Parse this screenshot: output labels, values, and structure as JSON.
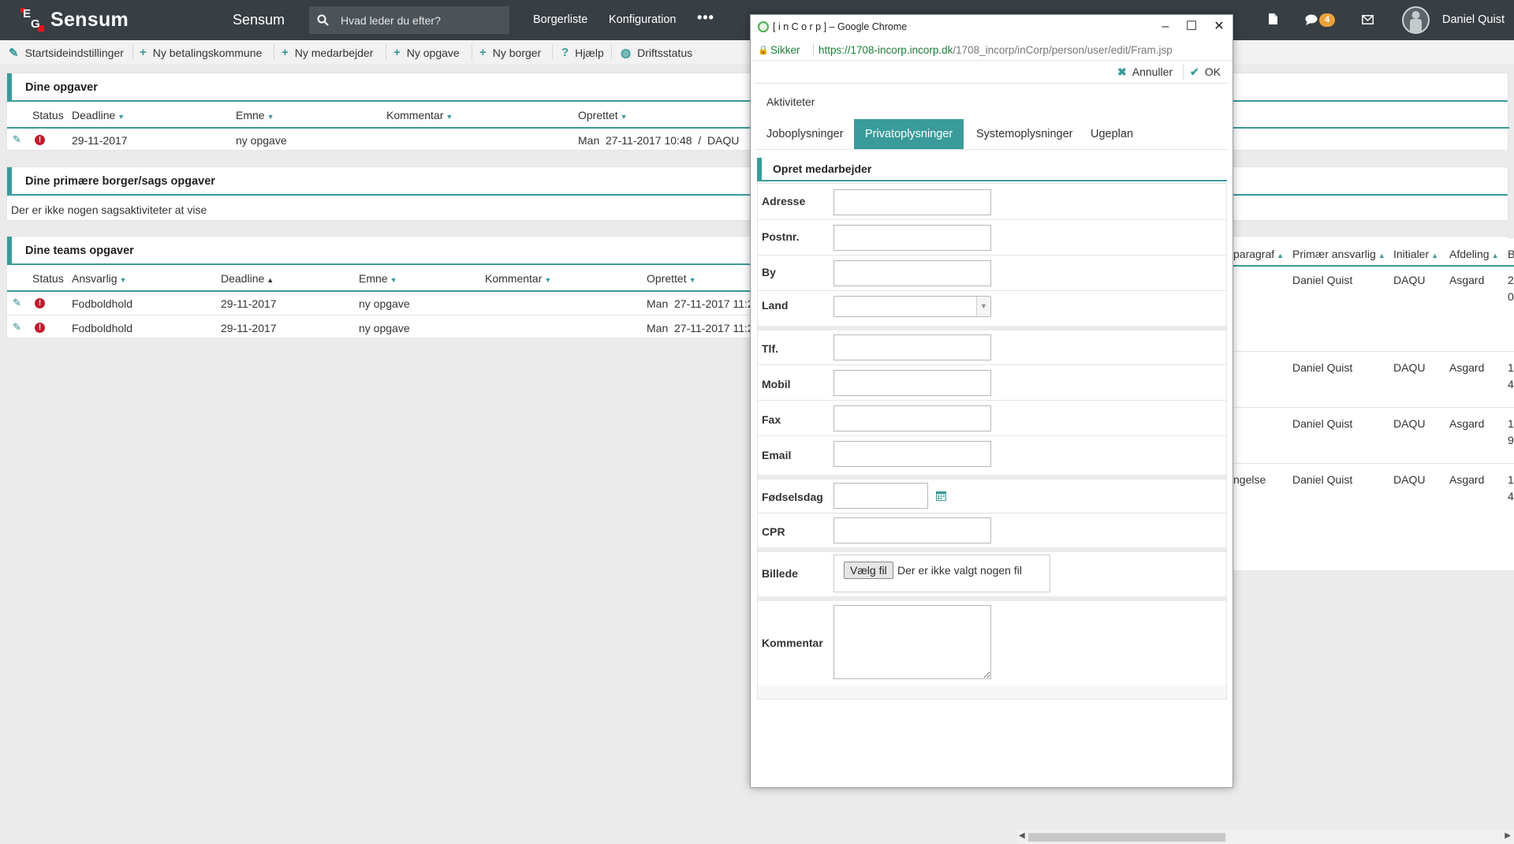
{
  "topbar": {
    "logo_text": "Sensum",
    "app_title": "Sensum",
    "search_placeholder": "Hvad leder du efter?",
    "nav": [
      "Borgerliste",
      "Konfiguration"
    ],
    "more": "•••",
    "notification_count": "4",
    "user_name": "Daniel Quist"
  },
  "toolbar": [
    {
      "icon": "pencil-icon",
      "glyph": "✎",
      "label": "Startsideindstillinger"
    },
    {
      "icon": "plus-icon",
      "glyph": "+",
      "label": "Ny betalingskommune"
    },
    {
      "icon": "plus-icon",
      "glyph": "+",
      "label": "Ny medarbejder"
    },
    {
      "icon": "plus-icon",
      "glyph": "+",
      "label": "Ny opgave"
    },
    {
      "icon": "plus-icon",
      "glyph": "+",
      "label": "Ny borger"
    },
    {
      "icon": "question-icon",
      "glyph": "?",
      "label": "Hjælp"
    },
    {
      "icon": "globe-icon",
      "glyph": "◍",
      "label": "Driftsstatus"
    }
  ],
  "panel1": {
    "title": "Dine opgaver",
    "columns": [
      "Status",
      "Deadline",
      "Emne",
      "Kommentar",
      "Oprettet"
    ],
    "rows": [
      {
        "deadline": "29-11-2017",
        "emne": "ny opgave",
        "kommentar": "",
        "oprettet": "Man  27-11-2017 10:48  /  DAQU"
      }
    ]
  },
  "panel2": {
    "title": "Dine primære borger/sags opgaver",
    "empty": "Der er ikke nogen sagsaktiviteter at vise"
  },
  "panel3": {
    "title": "Dine teams opgaver",
    "columns": [
      "Status",
      "Ansvarlig",
      "Deadline",
      "Emne",
      "Kommentar",
      "Oprettet"
    ],
    "rows": [
      {
        "ansvarlig": "Fodboldhold",
        "deadline": "29-11-2017",
        "emne": "ny opgave",
        "kommentar": "",
        "oprettet": "Man  27-11-2017 11:2"
      },
      {
        "ansvarlig": "Fodboldhold",
        "deadline": "29-11-2017",
        "emne": "ny opgave",
        "kommentar": "",
        "oprettet": "Man  27-11-2017 11:2"
      }
    ]
  },
  "right_table": {
    "columns": [
      "paragraf",
      "Primær ansvarlig",
      "Initialer",
      "Afdeling",
      "B"
    ],
    "rows": [
      {
        "paragraf": "",
        "ansvarlig": "Daniel Quist",
        "initialer": "DAQU",
        "afdeling": "Asgard",
        "b1": "2",
        "b2": "0"
      },
      {
        "paragraf": "",
        "ansvarlig": "Daniel Quist",
        "initialer": "DAQU",
        "afdeling": "Asgard",
        "b1": "1",
        "b2": "4"
      },
      {
        "paragraf": "",
        "ansvarlig": "Daniel Quist",
        "initialer": "DAQU",
        "afdeling": "Asgard",
        "b1": "1",
        "b2": "9"
      },
      {
        "paragraf": "ngelse",
        "ansvarlig": "Daniel Quist",
        "initialer": "DAQU",
        "afdeling": "Asgard",
        "b1": "1",
        "b2": "4"
      }
    ]
  },
  "popup": {
    "window_title": "[ i n C o r p ] – Google Chrome",
    "secure_label": "Sikker",
    "url_host": "https://1708-incorp.incorp.dk",
    "url_path": "/1708_incorp/inCorp/person/user/edit/Fram.jsp",
    "cancel_label": "Annuller",
    "ok_label": "OK",
    "section_label": "Aktiviteter",
    "tabs": [
      "Joboplysninger",
      "Privatoplysninger",
      "Systemoplysninger",
      "Ugeplan"
    ],
    "active_tab": "Privatoplysninger",
    "form_title": "Opret medarbejder",
    "fields": {
      "adresse": {
        "label": "Adresse",
        "value": ""
      },
      "postnr": {
        "label": "Postnr.",
        "value": ""
      },
      "by": {
        "label": "By",
        "value": ""
      },
      "land": {
        "label": "Land",
        "value": ""
      },
      "tlf": {
        "label": "Tlf.",
        "value": ""
      },
      "mobil": {
        "label": "Mobil",
        "value": ""
      },
      "fax": {
        "label": "Fax",
        "value": ""
      },
      "email": {
        "label": "Email",
        "value": ""
      },
      "foedselsdag": {
        "label": "Fødselsdag",
        "value": ""
      },
      "cpr": {
        "label": "CPR",
        "value": ""
      },
      "billede": {
        "label": "Billede",
        "button": "Vælg fil",
        "status": "Der er ikke valgt nogen fil"
      },
      "kommentar": {
        "label": "Kommentar",
        "value": ""
      }
    }
  },
  "colors": {
    "accent": "#3a9b9b",
    "topbar": "#373e44",
    "badge": "#e8a33b",
    "error": "#c21b2b"
  }
}
